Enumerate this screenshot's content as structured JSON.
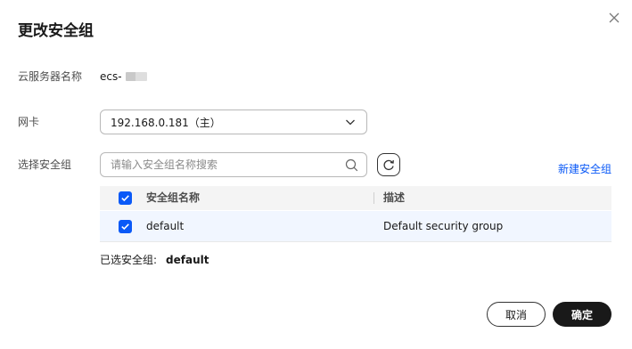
{
  "dialog": {
    "title": "更改安全组",
    "close_icon": "close-icon"
  },
  "fields": {
    "server_name_label": "云服务器名称",
    "server_name_value": "ecs-",
    "nic_label": "网卡",
    "nic_value": "192.168.0.181（主）",
    "sg_label": "选择安全组"
  },
  "search": {
    "placeholder": "请输入安全组名称搜索",
    "value": ""
  },
  "actions": {
    "create_link": "新建安全组"
  },
  "table": {
    "columns": [
      "安全组名称",
      "描述"
    ],
    "rows": [
      {
        "checked": true,
        "name": "default",
        "description": "Default security group"
      }
    ]
  },
  "selection": {
    "label": "已选安全组:",
    "value": "default"
  },
  "footer": {
    "cancel_label": "取消",
    "ok_label": "确定"
  },
  "colors": {
    "accent": "#0a59f7",
    "primary_button": "#191919",
    "row_selected": "#f1f6ff",
    "header_bg": "#f4f4f4"
  }
}
